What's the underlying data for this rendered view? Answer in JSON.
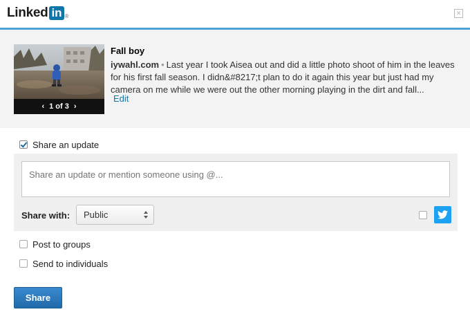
{
  "header": {
    "logo_text": "Linked",
    "logo_in": "in",
    "logo_reg": "®",
    "close_glyph": "✕"
  },
  "preview": {
    "title": "Fall boy",
    "source": "iywahl.com",
    "bullet": "•",
    "description": "Last year I took Aisea out and did a little photo shoot of him in the leaves for his first fall season. I didn&#8217;t plan to do it again this year but just had my camera on me while we were out the other morning playing in the dirt and fall...",
    "edit_label": "Edit",
    "nav": {
      "prev": "‹",
      "counter": "1 of 3",
      "next": "›"
    }
  },
  "share_update": {
    "label": "Share an update",
    "checked": true,
    "placeholder": "Share an update or mention someone using @...",
    "value": ""
  },
  "share_with": {
    "label": "Share with:",
    "selected": "Public"
  },
  "twitter": {
    "checked": false,
    "icon": "twitter-icon",
    "color": "#1da1f2"
  },
  "options": [
    {
      "label": "Post to groups",
      "checked": false
    },
    {
      "label": "Send to individuals",
      "checked": false
    }
  ],
  "share_button": {
    "label": "Share"
  },
  "colors": {
    "accent": "#4aa3d4",
    "brand": "#0e76a8",
    "button": "#2a78bd"
  }
}
